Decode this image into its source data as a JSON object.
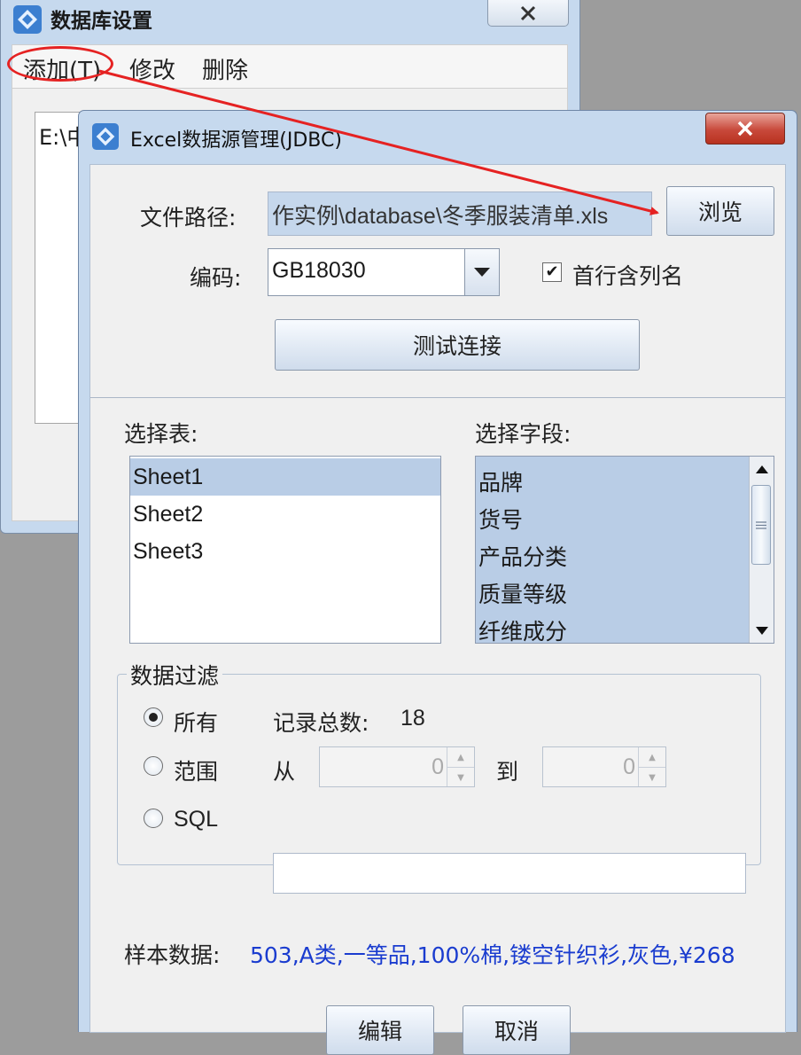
{
  "back_window": {
    "title": "数据库设置",
    "menu": [
      "添加(T)",
      "修改",
      "删除"
    ],
    "list_item": "E:\\中"
  },
  "dialog": {
    "title": "Excel数据源管理(JDBC)",
    "file_path_label": "文件路径:",
    "file_path_value": "作实例\\database\\冬季服装清单.xls",
    "browse_button": "浏览",
    "encoding_label": "编码:",
    "encoding_value": "GB18030",
    "header_checkbox_label": "首行含列名",
    "header_checkbox_checked": true,
    "test_button": "测试连接",
    "select_table_label": "选择表:",
    "tables": [
      "Sheet1",
      "Sheet2",
      "Sheet3"
    ],
    "selected_table": "Sheet1",
    "select_field_label": "选择字段:",
    "fields": [
      "品牌",
      "货号",
      "产品分类",
      "质量等级",
      "纤维成分"
    ],
    "filter_group_label": "数据过滤",
    "filter_all_label": "所有",
    "record_total_label": "记录总数:",
    "record_total_value": "18",
    "filter_range_label": "范围",
    "range_from_label": "从",
    "range_from_value": "0",
    "range_to_label": "到",
    "range_to_value": "0",
    "filter_sql_label": "SQL",
    "selected_filter": "所有",
    "sample_label": "样本数据:",
    "sample_value": "503,A类,一等品,100%棉,镂空针织衫,灰色,¥268",
    "edit_button": "编辑",
    "cancel_button": "取消"
  },
  "colors": {
    "annotation": "#e52222",
    "sample_text": "#1a3ccf",
    "selection": "#b9cde6",
    "title_bar": "#c6d9ee"
  }
}
